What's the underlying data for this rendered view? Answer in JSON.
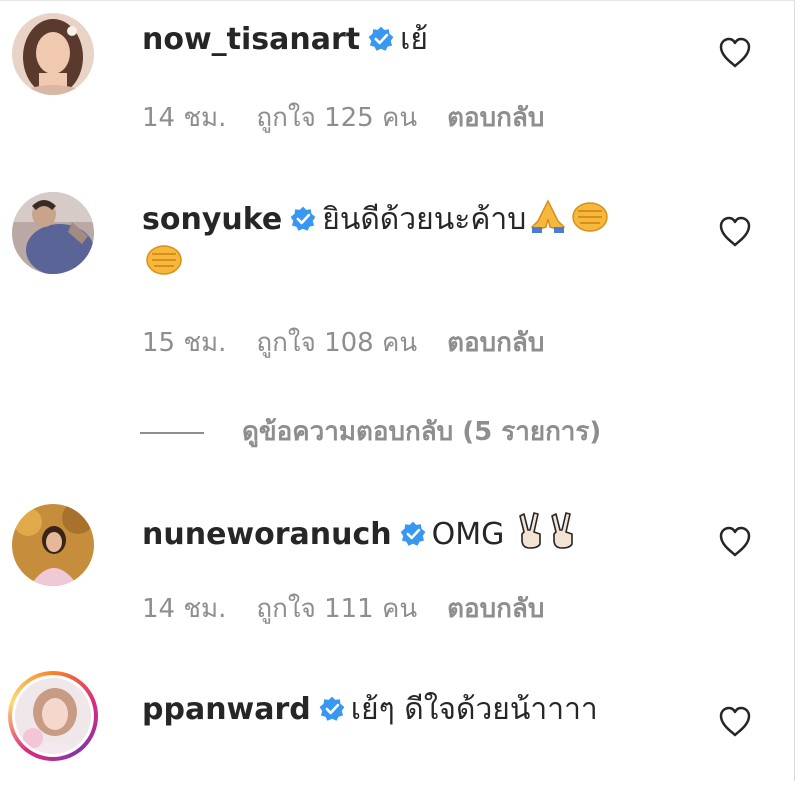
{
  "comments": [
    {
      "username": "now_tisanart",
      "text": "เย้",
      "time": "14 ชม.",
      "likes": "ถูกใจ 125 คน",
      "reply": "ตอบกลับ"
    },
    {
      "username": "sonyuke",
      "text": "ยินดีด้วยนะค้าบ",
      "emoji": [
        "folded-hands",
        "oncoming-fist",
        "oncoming-fist"
      ],
      "time": "15 ชม.",
      "likes": "ถูกใจ 108 คน",
      "reply": "ตอบกลับ"
    },
    {
      "username": "nuneworanuch",
      "text": "OMG",
      "emoji": [
        "victory-hand",
        "victory-hand"
      ],
      "time": "14 ชม.",
      "likes": "ถูกใจ 111 คน",
      "reply": "ตอบกลับ"
    },
    {
      "username": "ppanward",
      "text": "เย้ๆ ดีใจด้วยน้าาาา",
      "time": "",
      "likes": "",
      "reply": ""
    }
  ],
  "view_replies": "ดูข้อความตอบกลับ (5 รายการ)",
  "colors": {
    "text": "#262626",
    "secondary": "#8e8e8e",
    "verified": "#3897f0"
  },
  "icons": {
    "verified": "verified-badge-icon",
    "like": "heart-outline-icon"
  }
}
